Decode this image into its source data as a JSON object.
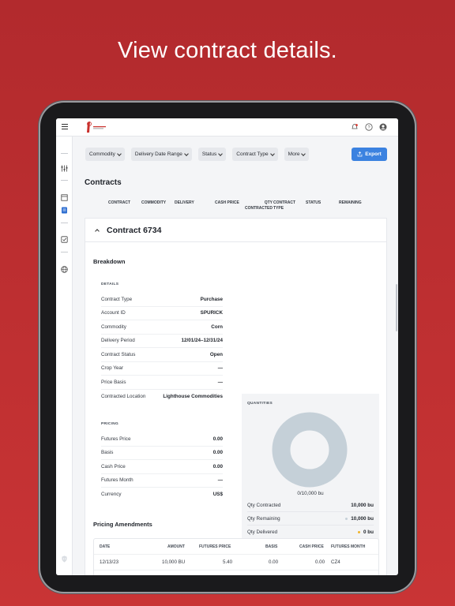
{
  "headline": "View contract details.",
  "colors": {
    "background": "#c0302f",
    "accent": "#3b82e0",
    "donut": "#c5d0d8"
  },
  "topbar": {
    "icons": [
      "menu-icon",
      "company-logo",
      "notification-icon",
      "help-icon",
      "account-icon"
    ]
  },
  "sidebar": {
    "icons": [
      "filters-icon",
      "document-icon",
      "contracts-icon",
      "checklist-icon",
      "globe-icon",
      "shield-icon"
    ]
  },
  "filters": [
    {
      "label": "Commodity"
    },
    {
      "label": "Delivery Date Range"
    },
    {
      "label": "Status"
    },
    {
      "label": "Contract Type"
    },
    {
      "label": "More"
    }
  ],
  "export_label": "Export",
  "page_title": "Contracts",
  "columns": {
    "contract": "CONTRACT",
    "commodity": "COMMODITY",
    "delivery": "DELIVERY",
    "cash_price": "CASH PRICE",
    "qty_contracted": "QTY\nCONTRACTED",
    "contract_type": "CONTRACT\nTYPE",
    "status": "STATUS",
    "remaining": "REMAINING"
  },
  "contract": {
    "title": "Contract 6734",
    "breakdown_label": "Breakdown",
    "details_label": "DETAILS",
    "details": [
      {
        "k": "Contract Type",
        "v": "Purchase"
      },
      {
        "k": "Account ID",
        "v": "SPURICK"
      },
      {
        "k": "Commodity",
        "v": "Corn"
      },
      {
        "k": "Delivery Period",
        "v": "12/01/24–12/31/24"
      },
      {
        "k": "Contract Status",
        "v": "Open"
      },
      {
        "k": "Crop Year",
        "v": "—"
      },
      {
        "k": "Price Basis",
        "v": "—"
      },
      {
        "k": "Contracted Location",
        "v": "Lighthouse Commodities"
      }
    ],
    "pricing_label": "PRICING",
    "pricing": [
      {
        "k": "Futures Price",
        "v": "0.00"
      },
      {
        "k": "Basis",
        "v": "0.00"
      },
      {
        "k": "Cash Price",
        "v": "0.00"
      },
      {
        "k": "Futures Month",
        "v": "—"
      },
      {
        "k": "Currency",
        "v": "US$"
      }
    ],
    "quantities_label": "QUANTITIES",
    "donut_caption": "0/10,000 bu",
    "delivered_fraction": 0,
    "quantities": [
      {
        "k": "Qty Contracted",
        "v": "10,000 bu",
        "dot": ""
      },
      {
        "k": "Qty Remaining",
        "v": "10,000 bu",
        "dot": "#c5d0d8"
      },
      {
        "k": "Qty Delivered",
        "v": "0 bu",
        "dot": "#f0b429"
      }
    ],
    "amendments_label": "Pricing Amendments",
    "amendment_columns": [
      "DATE",
      "AMOUNT",
      "FUTURES PRICE",
      "BASIS",
      "CASH PRICE",
      "FUTURES MONTH"
    ],
    "amendments": [
      [
        "12/13/23",
        "10,000 BU",
        "5.40",
        "0.00",
        "0.00",
        "CZ4"
      ]
    ]
  }
}
